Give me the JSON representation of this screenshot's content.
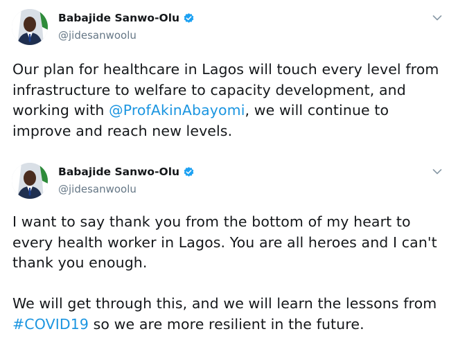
{
  "tweets": [
    {
      "display_name": "Babajide Sanwo-Olu",
      "handle": "@jidesanwoolu",
      "text_before_mention": "Our plan for healthcare in Lagos will touch every level from infrastructure to welfare to capacity development, and working with ",
      "mention": "@ProfAkinAbayomi",
      "text_after_mention": ", we will continue to improve and reach new levels."
    },
    {
      "display_name": "Babajide Sanwo-Olu",
      "handle": "@jidesanwoolu",
      "paragraph_1": "I want to say thank you from the bottom of my heart to every health worker in Lagos. You are all heroes and I can't thank you enough.",
      "paragraph_2_before_hashtag": "We will get through this, and we will learn the lessons from ",
      "hashtag": "#COVID19",
      "paragraph_2_after_hashtag": " so we are more resilient in the future."
    }
  ],
  "colors": {
    "link": "#1b95e0",
    "verified": "#1da1f2",
    "text": "#14171a",
    "secondary_text": "#657786"
  },
  "icons": {
    "verified": "verified-badge-icon",
    "menu": "chevron-down-icon"
  }
}
